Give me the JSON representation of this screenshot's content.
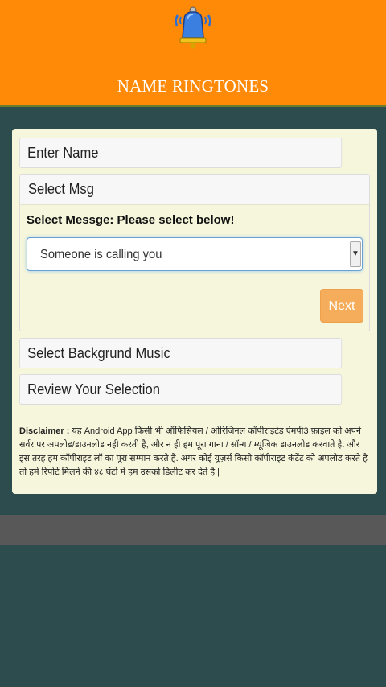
{
  "header": {
    "title": "NAME RINGTONES",
    "logo_icon": "bell-icon"
  },
  "steps": {
    "enter_name": "Enter Name",
    "select_msg": "Select Msg",
    "select_music": "Select Backgrund Music",
    "review": "Review Your Selection"
  },
  "message_step": {
    "label": "Select Messge: Please select below!",
    "selected_value": "Someone is calling you",
    "next_label": "Next"
  },
  "disclaimer": {
    "prefix": "Disclaimer :",
    "text": " यह Android App किसी भी ऑफिसियल / ओरिजिनल कॉपीराइटेड ऐमपी3 फ़ाइल को अपने सर्वर पर अपलोड/डाउनलोड नही करती है, और न ही हम पूरा गाना / सॉन्ग / म्यूजिक डाउनलोड करवाते है. और इस तरह हम कॉपीराइट लॉ का पूरा सम्मान करते है. अगर कोई यूज़र्स किसी कॉपीराइट कंटेंट को अपलोड करते है तो हमे रिपोर्ट मिलने की ४८ घंटो में हम उसको डिलीट कर देते है |"
  },
  "colors": {
    "header_bg": "#ff8a08",
    "page_bg": "#2d4c4e",
    "panel_bg": "#f6f6dc",
    "next_button": "#f5ad5c"
  }
}
